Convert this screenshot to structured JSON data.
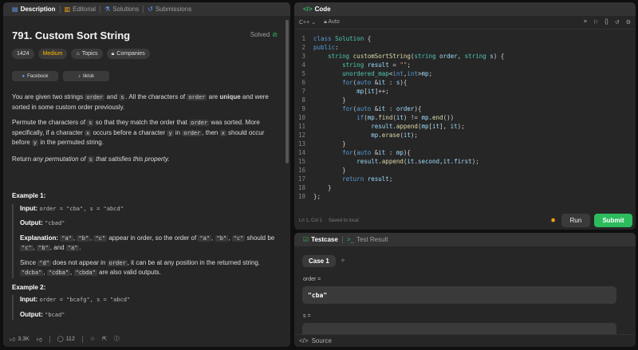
{
  "left_tabs": [
    {
      "label": "Description",
      "icon": "doc-icon"
    },
    {
      "label": "Editorial",
      "icon": "book-icon"
    },
    {
      "label": "Solutions",
      "icon": "flask-icon"
    },
    {
      "label": "Submissions",
      "icon": "history-icon"
    }
  ],
  "problem": {
    "title": "791. Custom Sort String",
    "solved": "Solved",
    "tags": [
      "1424",
      "Medium",
      "Topics",
      "Companies"
    ],
    "social": [
      "Facebook",
      "tiktok"
    ]
  },
  "desc": {
    "p1a": "You are given two strings ",
    "order": "order",
    "and": " and ",
    "s": "s",
    "p1b": ". All the characters of ",
    "p1c": " are ",
    "unique": "unique",
    "p1d": " and were sorted in some custom order previously.",
    "p2a": "Permute the characters of ",
    "p2b": " so that they match the order that ",
    "p2c": " was sorted. More specifically, if a character ",
    "x": "x",
    "p2d": " occurs before a character ",
    "y": "y",
    "p2e": " in ",
    "p2f": ", then ",
    "p2g": " should occur before ",
    "p2h": " in the permuted string.",
    "p3a": "Return ",
    "p3b": "any permutation of ",
    "p3c": " that satisfies this property."
  },
  "ex1": {
    "heading": "Example 1:",
    "input_label": "Input:",
    "input": "order = \"cba\", s = \"abcd\"",
    "output_label": "Output:",
    "output": "\"cbad\"",
    "expl_label": "Explanation:",
    "a": "\"a\"",
    "b": "\"b\"",
    "c": "\"c\"",
    "e1": " appear in order, so the order of ",
    "e2": " should be ",
    "e3": ", and ",
    "d": "\"d\"",
    "n1": "Since ",
    "n2": " does not appear in ",
    "n3": ", it can be at any position in the returned string. ",
    "dcba": "\"dcba\"",
    "cdba": "\"cdba\"",
    "cbda": "\"cbda\"",
    "n4": " are also valid outputs."
  },
  "ex2": {
    "heading": "Example 2:",
    "input_label": "Input:",
    "input": "order = \"bcafg\", s = \"abcd\"",
    "output_label": "Output:",
    "output": "\"bcad\""
  },
  "footer": {
    "likes": "3.3K",
    "comments": "112"
  },
  "code": {
    "tab": "Code",
    "lang": "C++",
    "auto": "Auto",
    "status_pos": "Ln 1, Col 1",
    "status_saved": "Saved to local",
    "run": "Run",
    "submit": "Submit"
  },
  "test": {
    "tab1": "Testcase",
    "tab2": "Test Result",
    "case": "Case 1",
    "label_order": "order =",
    "value_order": "\"cba\"",
    "label_s": "s =",
    "source": "Source"
  }
}
